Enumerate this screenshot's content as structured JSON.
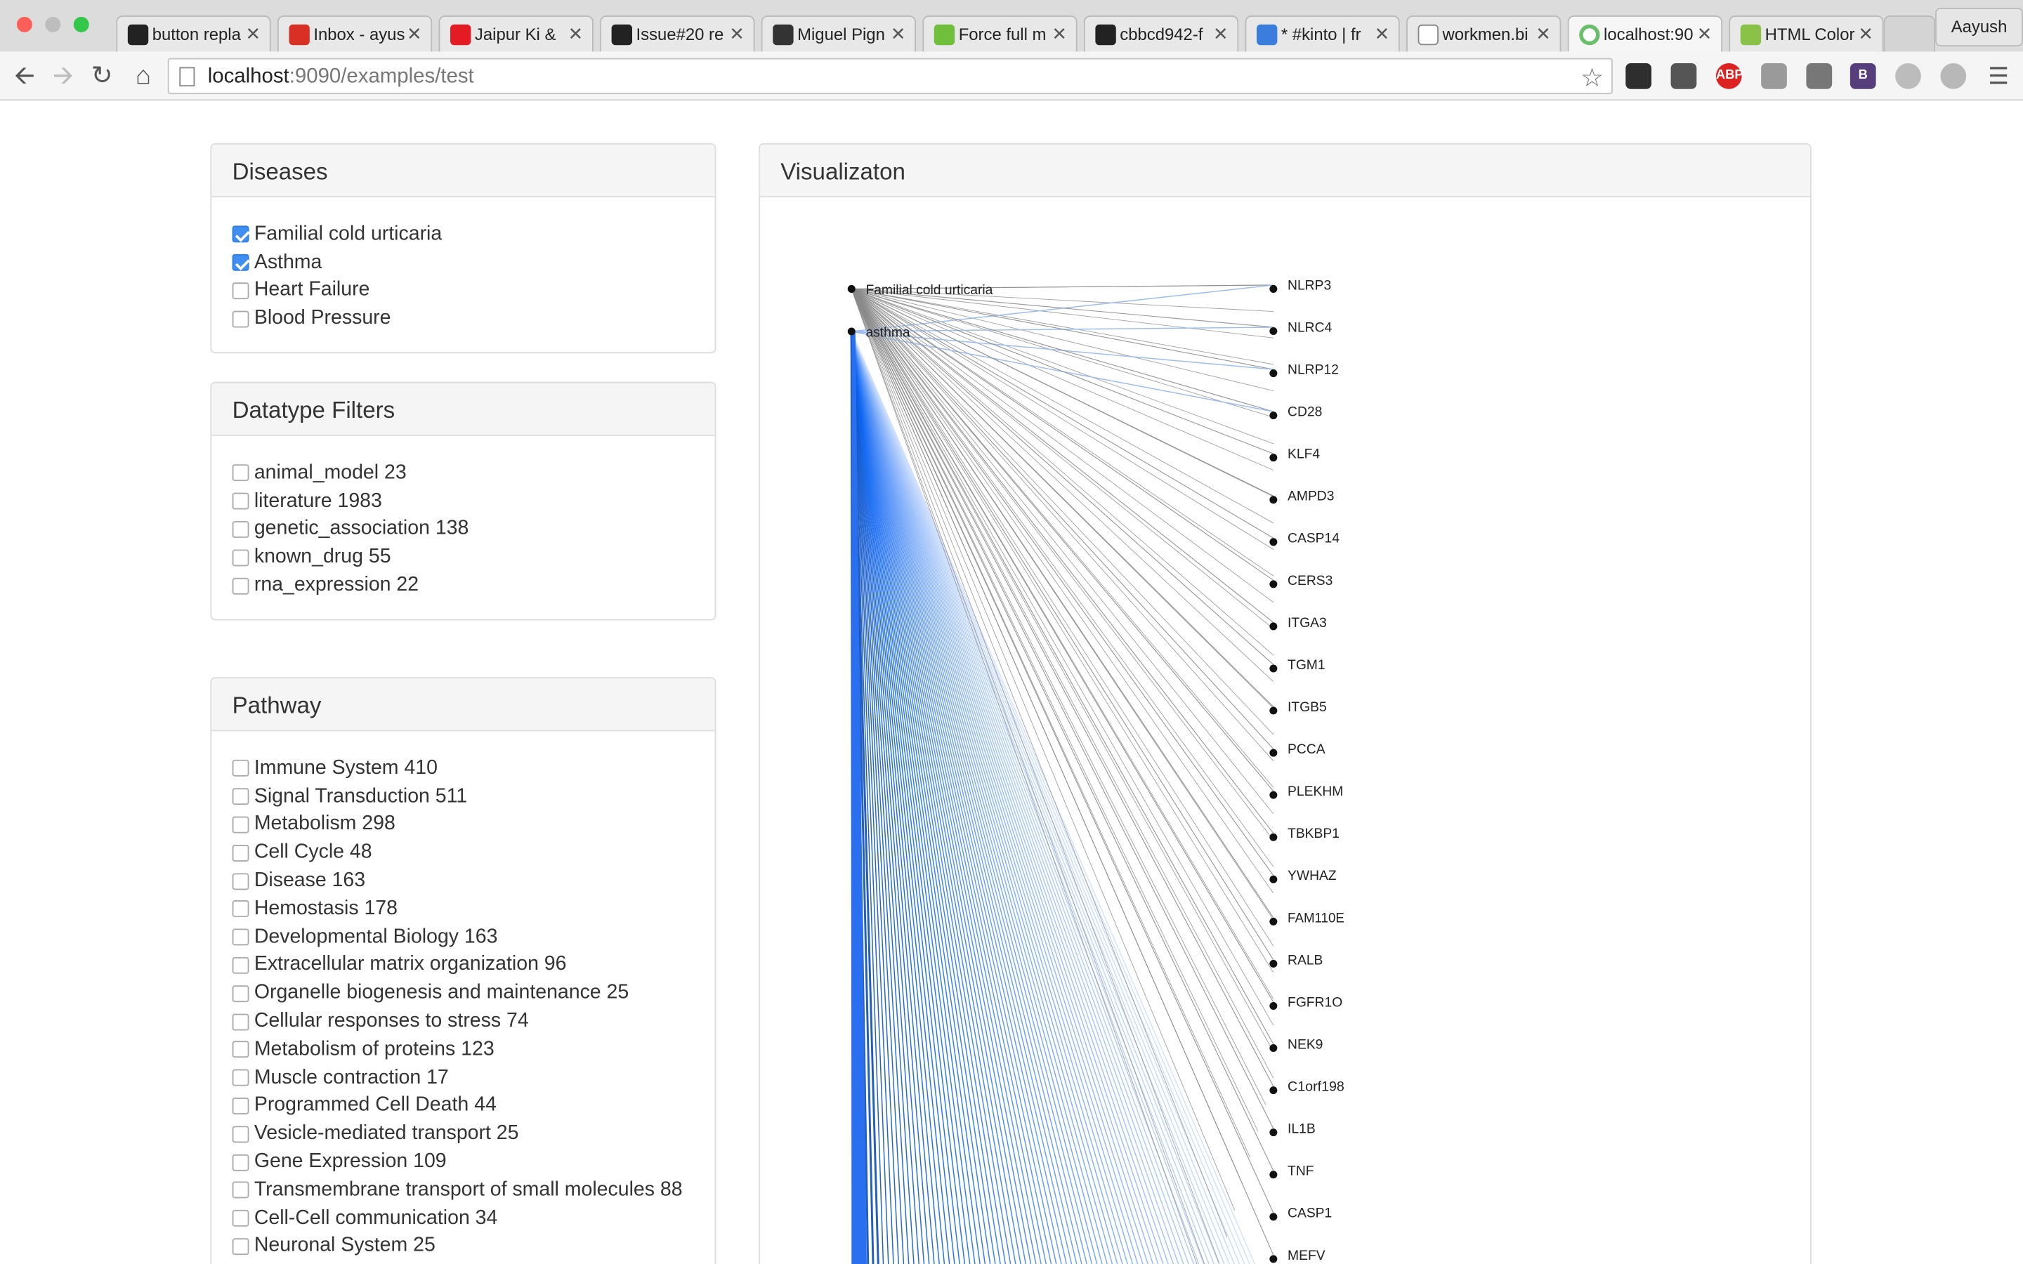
{
  "browser": {
    "tabs": [
      {
        "label": "button repla",
        "icon": "github-icon"
      },
      {
        "label": "Inbox - ayus",
        "icon": "gmail-icon"
      },
      {
        "label": "Jaipur Ki &",
        "icon": "my-icon"
      },
      {
        "label": "Issue#20 re",
        "icon": "github-icon"
      },
      {
        "label": "Miguel Pign",
        "icon": "site-icon"
      },
      {
        "label": "Force full m",
        "icon": "jsfiddle-icon"
      },
      {
        "label": "cbbcd942-f",
        "icon": "github-icon"
      },
      {
        "label": "* #kinto | fr",
        "icon": "cloud-icon"
      },
      {
        "label": "workmen.bi",
        "icon": "page-icon"
      },
      {
        "label": "localhost:90",
        "icon": "loading-icon"
      },
      {
        "label": "HTML Color",
        "icon": "color-icon"
      }
    ],
    "active_tab": 9,
    "profile": "Aayush",
    "url_host": "localhost",
    "url_rest": ":9090/examples/test"
  },
  "diseases_panel": {
    "title": "Diseases",
    "items": [
      {
        "label": "Familial cold urticaria",
        "checked": true
      },
      {
        "label": "Asthma",
        "checked": true
      },
      {
        "label": "Heart Failure",
        "checked": false
      },
      {
        "label": "Blood Pressure",
        "checked": false
      }
    ]
  },
  "datatype_panel": {
    "title": "Datatype Filters",
    "items": [
      {
        "label": "animal_model 23",
        "checked": false
      },
      {
        "label": "literature 1983",
        "checked": false
      },
      {
        "label": "genetic_association 138",
        "checked": false
      },
      {
        "label": "known_drug 55",
        "checked": false
      },
      {
        "label": "rna_expression 22",
        "checked": false
      }
    ]
  },
  "pathway_panel": {
    "title": "Pathway",
    "items": [
      {
        "label": "Immune System 410",
        "checked": false
      },
      {
        "label": "Signal Transduction 511",
        "checked": false
      },
      {
        "label": "Metabolism 298",
        "checked": false
      },
      {
        "label": "Cell Cycle 48",
        "checked": false
      },
      {
        "label": "Disease 163",
        "checked": false
      },
      {
        "label": "Hemostasis 178",
        "checked": false
      },
      {
        "label": "Developmental Biology 163",
        "checked": false
      },
      {
        "label": "Extracellular matrix organization 96",
        "checked": false
      },
      {
        "label": "Organelle biogenesis and maintenance 25",
        "checked": false
      },
      {
        "label": "Cellular responses to stress 74",
        "checked": false
      },
      {
        "label": "Metabolism of proteins 123",
        "checked": false
      },
      {
        "label": "Muscle contraction 17",
        "checked": false
      },
      {
        "label": "Programmed Cell Death 44",
        "checked": false
      },
      {
        "label": "Vesicle-mediated transport 25",
        "checked": false
      },
      {
        "label": "Gene Expression 109",
        "checked": false
      },
      {
        "label": "Transmembrane transport of small molecules 88",
        "checked": false
      },
      {
        "label": "Cell-Cell communication 34",
        "checked": false
      },
      {
        "label": "Neuronal System 25",
        "checked": false
      }
    ]
  },
  "visualization": {
    "title": "Visualizaton",
    "diseases": [
      "Familial cold urticaria",
      "asthma"
    ],
    "genes": [
      "NLRP3",
      "NLRC4",
      "NLRP12",
      "CD28",
      "KLF4",
      "AMPD3",
      "CASP14",
      "CERS3",
      "ITGA3",
      "TGM1",
      "ITGB5",
      "PCCA",
      "PLEKHM",
      "TBKBP1",
      "YWHAZ",
      "FAM110E",
      "RALB",
      "FGFR1O",
      "NEK9",
      "C1orf198",
      "IL1B",
      "TNF",
      "CASP1",
      "MEFV"
    ],
    "colors": {
      "disease_edge": "#8a8a8a",
      "gene_edge": "#2a6ff0",
      "node": "#111111"
    }
  }
}
